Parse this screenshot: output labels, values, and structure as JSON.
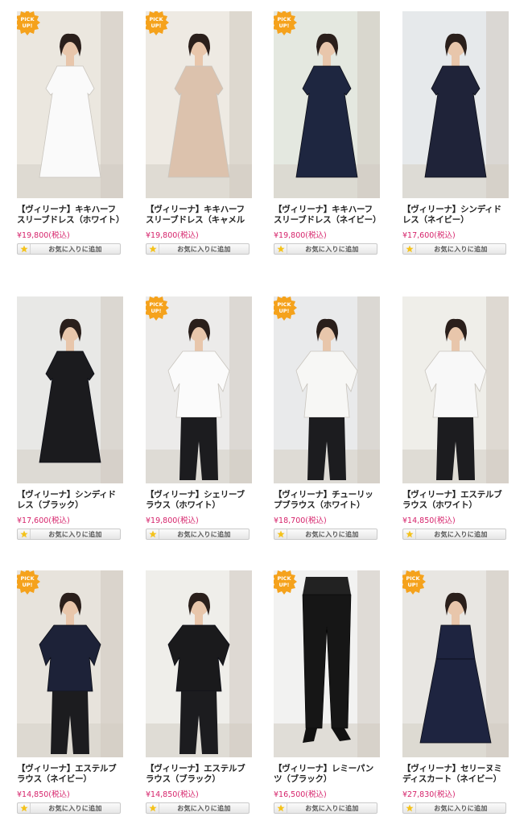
{
  "colors": {
    "price": "#d6236b",
    "pickup_badge": "#f5a21c",
    "star": "#f4c21b"
  },
  "pickup_badge_text": "PICK UP!",
  "favorite_label": "お気に入りに追加",
  "products": [
    {
      "name": "【ヴィリーナ】キキハーフスリーブドレス（ホワイト）",
      "price": "¥19,800(税込)",
      "pickup": true,
      "garment": "dress",
      "color": "#fafafa"
    },
    {
      "name": "【ヴィリーナ】キキハーフスリーブドレス（キャメルベージュ）",
      "price": "¥19,800(税込)",
      "pickup": true,
      "garment": "dress",
      "color": "#dcc2ad"
    },
    {
      "name": "【ヴィリーナ】キキハーフスリーブドレス（ネイビー）",
      "price": "¥19,800(税込)",
      "pickup": true,
      "garment": "dress",
      "color": "#1e2640"
    },
    {
      "name": "【ヴィリーナ】シンディドレス（ネイビー）",
      "price": "¥17,600(税込)",
      "pickup": false,
      "garment": "dress",
      "color": "#1f2339"
    },
    {
      "name": "【ヴィリーナ】シンディドレス（ブラック）",
      "price": "¥17,600(税込)",
      "pickup": false,
      "garment": "dress",
      "color": "#1b1b1e"
    },
    {
      "name": "【ヴィリーナ】シェリーブラウス（ホワイト）",
      "price": "¥19,800(税込)",
      "pickup": true,
      "garment": "blouse",
      "color": "#fbfbfb"
    },
    {
      "name": "【ヴィリーナ】チューリップブラウス（ホワイト）",
      "price": "¥18,700(税込)",
      "pickup": true,
      "garment": "blouse",
      "color": "#f7f7f5"
    },
    {
      "name": "【ヴィリーナ】エステルブラウス（ホワイト）",
      "price": "¥14,850(税込)",
      "pickup": false,
      "garment": "blouse",
      "color": "#f8f8f8"
    },
    {
      "name": "【ヴィリーナ】エステルブラウス（ネイビー）",
      "price": "¥14,850(税込)",
      "pickup": true,
      "garment": "blouse",
      "color": "#1d2238"
    },
    {
      "name": "【ヴィリーナ】エステルブラウス（ブラック）",
      "price": "¥14,850(税込)",
      "pickup": false,
      "garment": "blouse",
      "color": "#1a1a1c"
    },
    {
      "name": "【ヴィリーナ】レミーパンツ（ブラック）",
      "price": "¥16,500(税込)",
      "pickup": true,
      "garment": "pants",
      "color": "#161616"
    },
    {
      "name": "【ヴィリーナ】セリーヌミディスカート（ネイビー）",
      "price": "¥27,830(税込)",
      "pickup": true,
      "garment": "skirt",
      "color": "#1e2440"
    }
  ]
}
